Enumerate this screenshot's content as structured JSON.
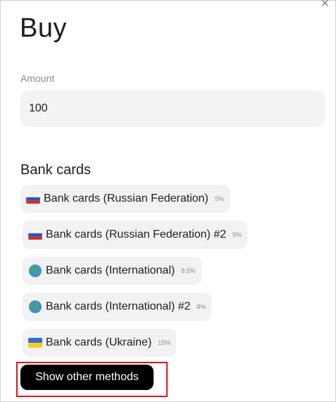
{
  "dialog": {
    "title": "Buy",
    "close_icon": "close-icon"
  },
  "amount": {
    "label": "Amount",
    "value": "100"
  },
  "bank_cards": {
    "section_title": "Bank cards",
    "methods": [
      {
        "label": "Bank cards (Russian Federation)",
        "fee": "5%",
        "icon": "russia-flag-icon"
      },
      {
        "label": "Bank cards (Russian Federation) #2",
        "fee": "5%",
        "icon": "russia-flag-icon"
      },
      {
        "label": "Bank cards (International)",
        "fee": "8.5%",
        "icon": "globe-icon"
      },
      {
        "label": "Bank cards (International) #2",
        "fee": "8%",
        "icon": "globe-icon"
      },
      {
        "label": "Bank cards (Ukraine)",
        "fee": "15%",
        "icon": "ukraine-flag-icon"
      }
    ]
  },
  "show_other": {
    "label": "Show other methods"
  },
  "colors": {
    "chip_bg": "#f2f2f2",
    "button_bg": "#000000",
    "highlight": "#e4141e"
  }
}
